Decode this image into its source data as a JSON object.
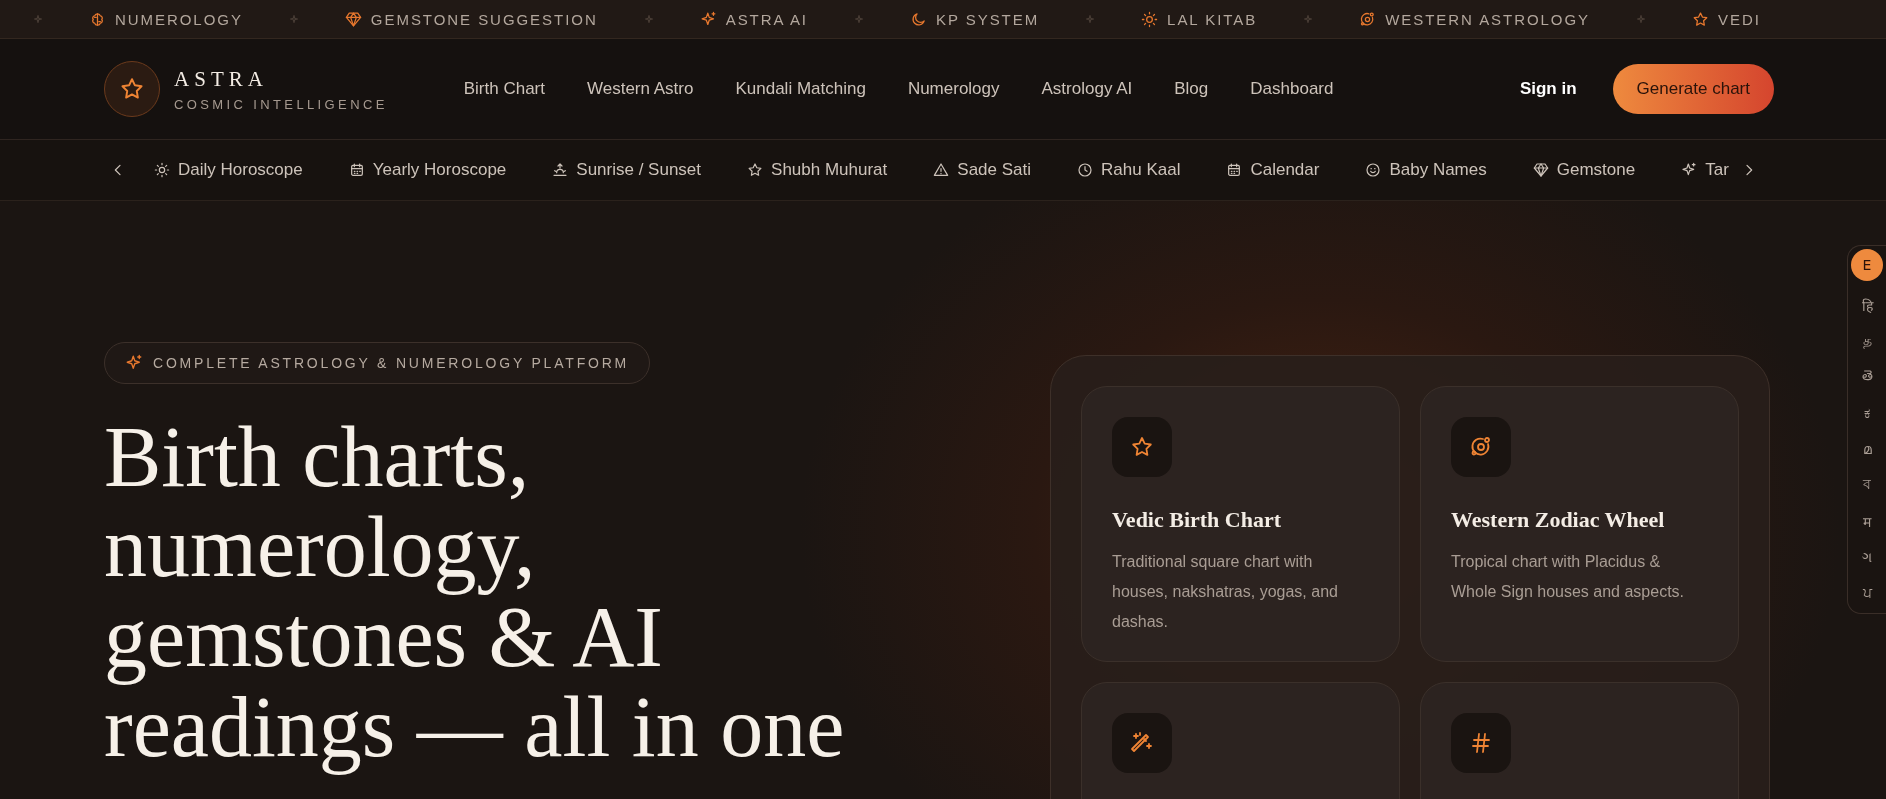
{
  "ticker": [
    {
      "label": "NUMEROLOGY"
    },
    {
      "label": "GEMSTONE SUGGESTION"
    },
    {
      "label": "ASTRA AI"
    },
    {
      "label": "KP SYSTEM"
    },
    {
      "label": "LAL KITAB"
    },
    {
      "label": "WESTERN ASTROLOGY"
    },
    {
      "label": "VEDI"
    }
  ],
  "brand": {
    "name": "ASTRA",
    "tagline": "COSMIC INTELLIGENCE"
  },
  "nav": {
    "links": [
      "Birth Chart",
      "Western Astro",
      "Kundali Matching",
      "Numerology",
      "Astrology AI",
      "Blog",
      "Dashboard"
    ],
    "sign_in": "Sign in",
    "cta": "Generate chart"
  },
  "subnav": {
    "items": [
      "Daily Horoscope",
      "Yearly Horoscope",
      "Sunrise / Sunset",
      "Shubh Muhurat",
      "Sade Sati",
      "Rahu Kaal",
      "Calendar",
      "Baby Names",
      "Gemstone",
      "Tar"
    ]
  },
  "languages": [
    {
      "label": "E",
      "selected": true
    },
    {
      "label": "हि",
      "selected": false
    },
    {
      "label": "த",
      "selected": false
    },
    {
      "label": "తె",
      "selected": false
    },
    {
      "label": "ಕ",
      "selected": false
    },
    {
      "label": "മ",
      "selected": false
    },
    {
      "label": "ব",
      "selected": false
    },
    {
      "label": "म",
      "selected": false
    },
    {
      "label": "ગ",
      "selected": false
    },
    {
      "label": "ਪ",
      "selected": false
    }
  ],
  "hero": {
    "badge": "COMPLETE ASTROLOGY & NUMEROLOGY PLATFORM",
    "heading": "Birth charts, numerology, gemstones & AI readings — all in one"
  },
  "features": [
    {
      "kind": "full",
      "title": "Vedic Birth Chart",
      "description": "Traditional square chart with houses, nakshatras, yogas, and dashas."
    },
    {
      "kind": "full",
      "title": "Western Zodiac Wheel",
      "description": "Tropical chart with Placidus & Whole Sign houses and aspects."
    },
    {
      "kind": "icon_only"
    },
    {
      "kind": "icon_only"
    }
  ]
}
